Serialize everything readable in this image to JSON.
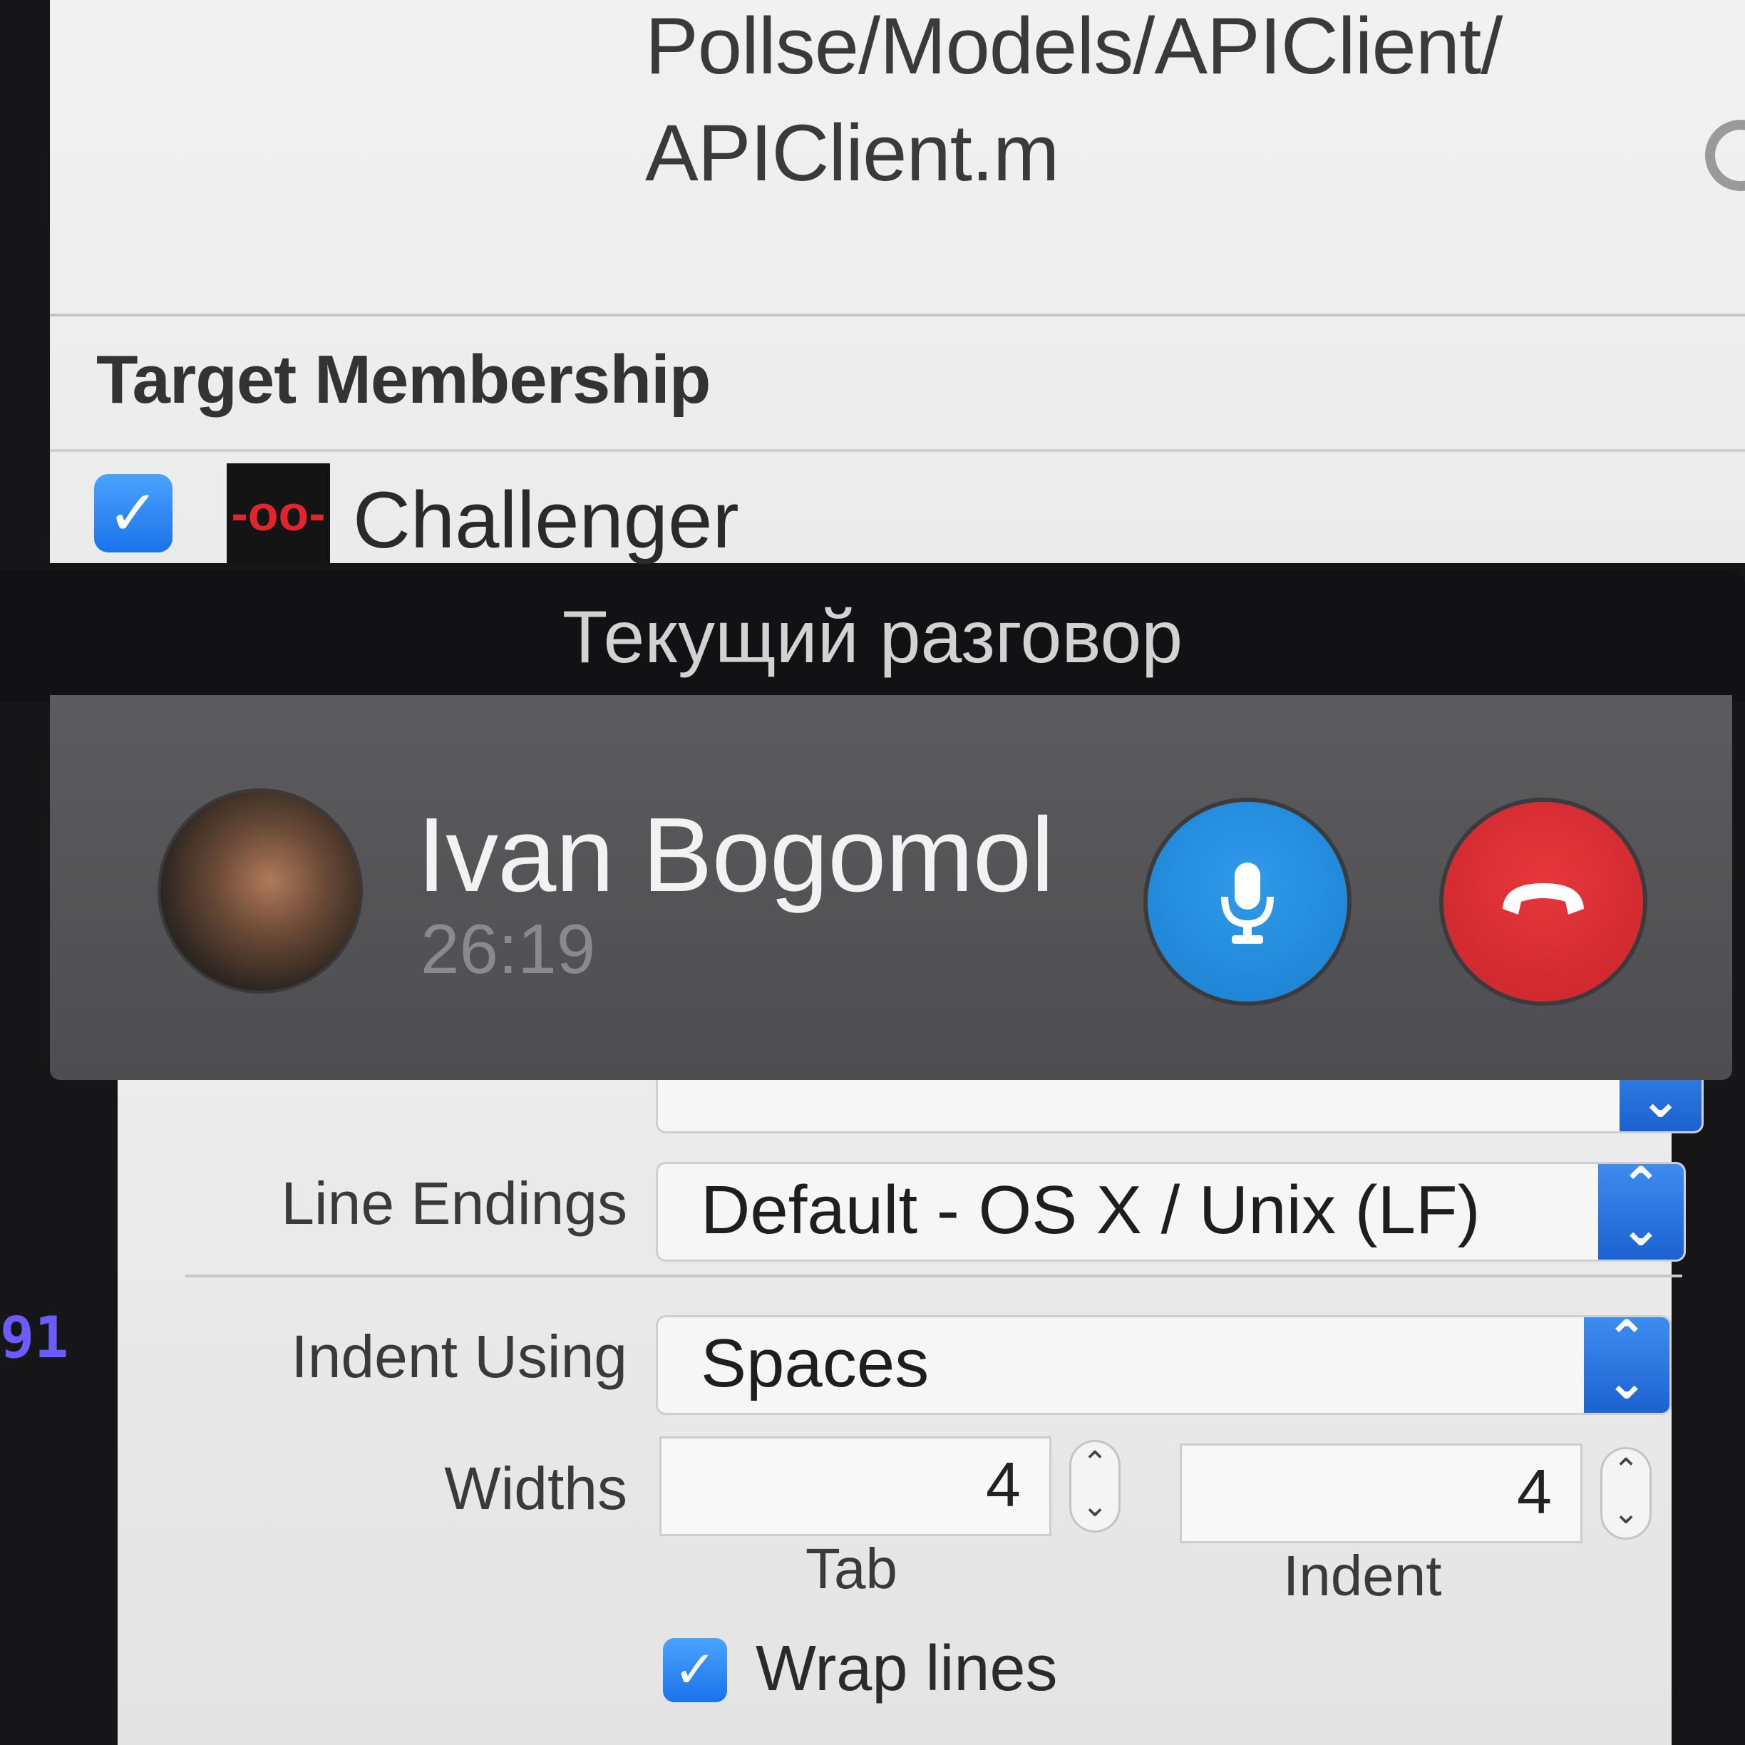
{
  "inspector": {
    "file_path_line1": "Pollse/Models/APIClient/",
    "file_path_line2": "APIClient.m",
    "target_membership": {
      "title": "Target Membership",
      "target_name": "Challenger",
      "target_checked": true,
      "target_icon_glyph": "-oo-"
    },
    "text_settings": {
      "line_endings_label": "Line Endings",
      "line_endings_value": "Default - OS X / Unix (LF)",
      "indent_using_label": "Indent Using",
      "indent_using_value": "Spaces",
      "widths_label": "Widths",
      "tab_width": "4",
      "tab_caption": "Tab",
      "indent_width": "4",
      "indent_caption": "Indent",
      "wrap_lines_label": "Wrap lines",
      "wrap_lines_checked": true
    },
    "gutter_line_number": "91"
  },
  "call": {
    "header_title": "Текущий разговор",
    "caller_name": "Ivan Bogomol",
    "duration": "26:19",
    "mute_icon": "microphone-icon",
    "hangup_icon": "phone-hangup-icon",
    "colors": {
      "mute_button": "#1b7fcf",
      "hangup_button": "#c9252a"
    }
  },
  "icons": {
    "checkmark": "✓",
    "popup_up": "⌃",
    "popup_down": "⌄"
  }
}
